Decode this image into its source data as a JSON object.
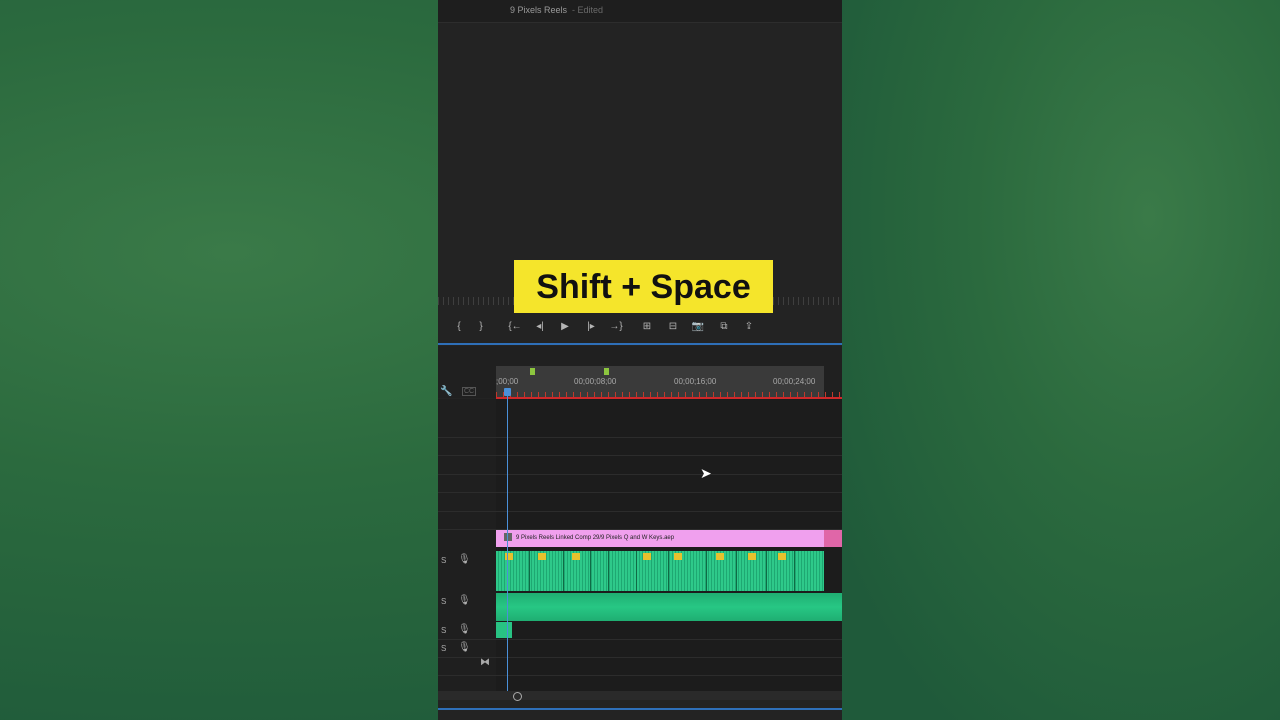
{
  "window": {
    "project_name": "9 Pixels Reels",
    "status": "- Edited"
  },
  "caption": {
    "text": "Shift + Space"
  },
  "transport": {
    "mark_in": "{",
    "mark_out": "}",
    "go_to_in": "{←",
    "step_back": "◂|",
    "play": "▶",
    "step_forward": "|▸",
    "go_to_out": "→}",
    "insert": "⊞",
    "overwrite": "⊟",
    "export_frame": "📷",
    "compare": "⧉",
    "share": "⇪"
  },
  "timeline": {
    "timecodes": [
      ";00;00",
      "00;00;08;00",
      "00;00;16;00",
      "00;00;24;00"
    ],
    "video_clip_label": "9 Pixels Reels Linked Comp 29/9 Pixels Q and W Keys.aep",
    "track_s_label": "S",
    "end_icon": "⧓"
  },
  "colors": {
    "accent": "#2e6fb8",
    "caption_bg": "#f5e52b",
    "video_clip": "#f0a0ee",
    "audio_clip": "#2ec98a"
  }
}
